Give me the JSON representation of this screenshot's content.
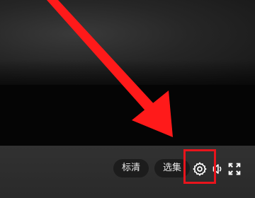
{
  "player": {
    "controls": {
      "quality_label": "标清",
      "episodes_label": "选集",
      "icons": {
        "settings": "gear-icon",
        "volume": "speaker-icon",
        "fullscreen": "fullscreen-icon"
      }
    }
  },
  "annotation": {
    "arrow_target": "settings-button",
    "highlight_color": "#e8141c",
    "arrow_color": "#ff1a1a"
  }
}
